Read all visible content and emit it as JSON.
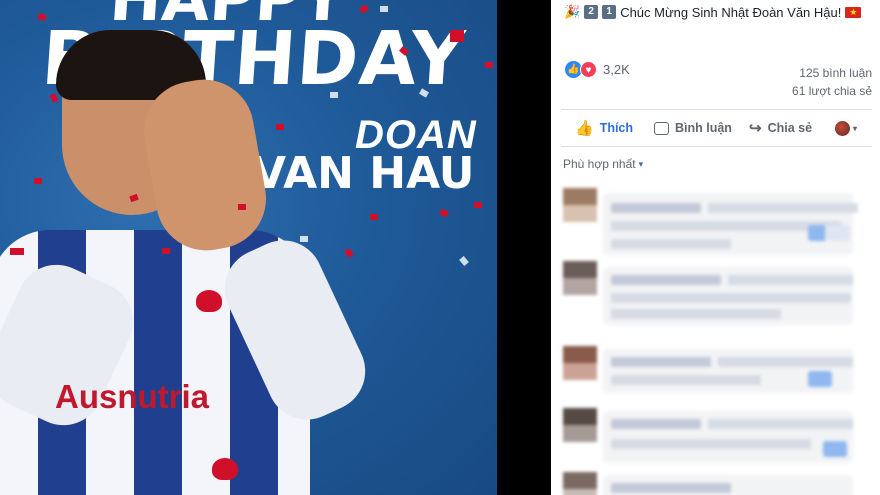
{
  "post": {
    "caption_text": "Chúc Mừng Sinh Nhật Đoàn Văn Hậu!",
    "caption_digit_1": "2",
    "caption_digit_2": "1",
    "caption_flag": "★",
    "caption_party": "🎉",
    "reaction_count": "3,2K",
    "comment_count": "125 bình luận",
    "share_count": "61 lượt chia sẻ"
  },
  "photo": {
    "title_partial": "HAPPY",
    "title": "BIRTHDAY",
    "name_first": "DOAN",
    "name_last": "VAN HAU",
    "sponsor": "Ausnutria"
  },
  "actions": {
    "like_label": "Thích",
    "comment_label": "Bình luận",
    "share_label": "Chia sẻ"
  },
  "sort": {
    "label": "Phù hợp nhất",
    "caret": "▾"
  },
  "icons": {
    "like": "👍",
    "share": "↪",
    "caret": "▾",
    "react_like": "👍",
    "react_love": "♥"
  },
  "colors": {
    "accent": "#2d6fd6",
    "like_reaction": "#2d88ff",
    "love_reaction": "#f33e58",
    "photo_background": "#1f5a99"
  }
}
